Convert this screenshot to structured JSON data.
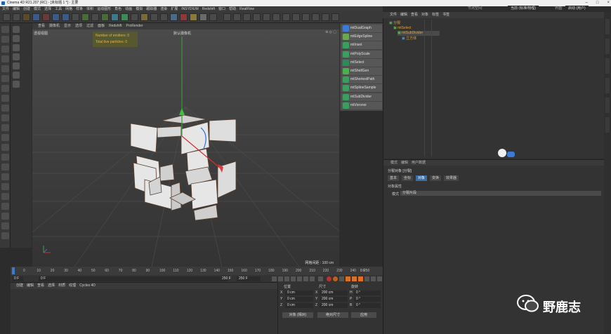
{
  "titlebar": {
    "title": "Cinema 4D R21.207 (RC) - [未标题 1 *] - 主要"
  },
  "menubar": {
    "items": [
      "文件",
      "编辑",
      "创建",
      "模式",
      "选择",
      "工具",
      "网格",
      "样条",
      "体积",
      "运动图形",
      "角色",
      "动画",
      "模拟",
      "跟踪器",
      "渲染",
      "扩展",
      "INSYDIUM",
      "Redshift",
      "窗口",
      "帮助",
      "RealFlow"
    ]
  },
  "viewport": {
    "menu": [
      "查看",
      "摄像机",
      "显示",
      "选项",
      "过滤",
      "面板",
      "Redshift",
      "ProRender"
    ],
    "view_label": "透视视图",
    "camera_label": "默认摄像机",
    "hud": {
      "emitters": "Number of emitters: 0",
      "particles": "Total live particles: 0"
    },
    "grid_label": "网格间距 : 100 cm"
  },
  "plugins": {
    "items": [
      {
        "label": "mtDualGraph",
        "color": "#3a7bd5"
      },
      {
        "label": "mtEdgeSpline",
        "color": "#6aa84f"
      },
      {
        "label": "mtInset",
        "color": "#3a9e5f"
      },
      {
        "label": "mtPolyScale",
        "color": "#3a9e5f"
      },
      {
        "label": "mtSelect",
        "color": "#2e8b57"
      },
      {
        "label": "mtShellGen",
        "color": "#4caf50"
      },
      {
        "label": "mtShortestPath",
        "color": "#3a9e5f"
      },
      {
        "label": "mtSplineSample",
        "color": "#3a9e5f"
      },
      {
        "label": "mtSubDivider",
        "color": "#3a9e5f"
      },
      {
        "label": "mtVoronoi",
        "color": "#3a9e5f"
      }
    ]
  },
  "object_manager": {
    "menu": [
      "文件",
      "编辑",
      "查看",
      "对象",
      "标签",
      "书签"
    ],
    "top_label": "节点空间:",
    "top_value": "当前 (标准/物理)",
    "layout_label": "界面:",
    "layout_value": "启动 (用户)",
    "rows": [
      {
        "label": "分裂"
      },
      {
        "label": "mtSelect"
      },
      {
        "label": "mtSubDivider"
      },
      {
        "label": "立方体"
      }
    ]
  },
  "attributes": {
    "menu": [
      "模式",
      "编辑",
      "用户数据"
    ],
    "object_title": "分裂对象 [分裂]",
    "tabs": [
      "基本",
      "坐标",
      "对象",
      "变换",
      "效果器"
    ],
    "section": "对象属性",
    "mode_label": "模式",
    "mode_value": "分裂片段"
  },
  "timeline": {
    "ticks": [
      "0",
      "10",
      "20",
      "30",
      "40",
      "50",
      "60",
      "70",
      "80",
      "90",
      "100",
      "110",
      "120",
      "130",
      "140",
      "150",
      "160",
      "170",
      "180",
      "190",
      "200",
      "210",
      "220",
      "230",
      "240",
      "250"
    ],
    "current_frame": "0 F",
    "start": "0 F",
    "start2": "0 F",
    "end": "250 F",
    "end2": "250 F"
  },
  "material_manager": {
    "menu": [
      "创建",
      "编辑",
      "查看",
      "选择",
      "材质",
      "纹理",
      "Cycles 4D"
    ]
  },
  "coordinates": {
    "headers": {
      "position": "位置",
      "size": "尺寸",
      "rotation": "旋转"
    },
    "rows": [
      {
        "axis": "X",
        "pos": "0 cm",
        "size_axis": "X",
        "size": "200 cm",
        "rot_axis": "H",
        "rot": "0 °"
      },
      {
        "axis": "Y",
        "pos": "0 cm",
        "size_axis": "Y",
        "size": "200 cm",
        "rot_axis": "P",
        "rot": "0 °"
      },
      {
        "axis": "Z",
        "pos": "0 cm",
        "size_axis": "Z",
        "size": "200 cm",
        "rot_axis": "B",
        "rot": "0 °"
      }
    ],
    "dropdown1": "对象 (相对)",
    "dropdown2": "绝对尺寸",
    "apply": "应用"
  },
  "watermark": {
    "text": "野鹿志"
  }
}
